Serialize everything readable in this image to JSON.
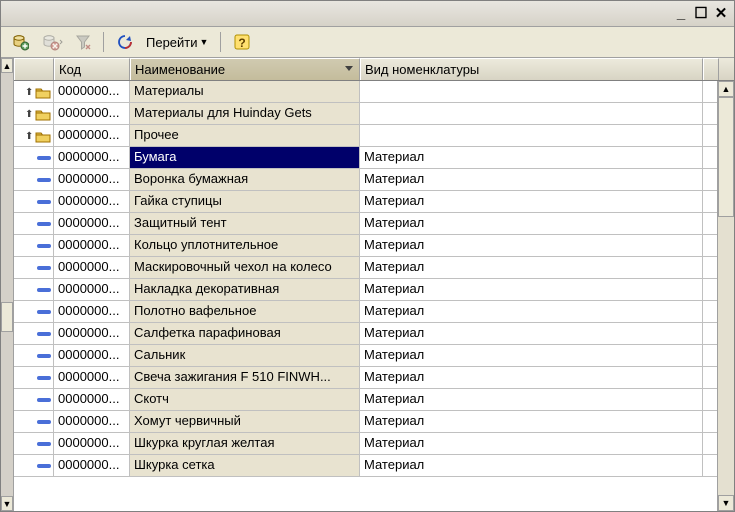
{
  "titlebar": {
    "minimize": "_",
    "maximize": "☐",
    "close": "✕"
  },
  "toolbar": {
    "goto_label": "Перейти",
    "goto_icon": "chevron-down"
  },
  "grid": {
    "headers": {
      "icon": "",
      "code": "Код",
      "name": "Наименование",
      "type": "Вид номенклатуры"
    },
    "rows": [
      {
        "kind": "folder",
        "code": "0000000...",
        "name": "Материалы",
        "type": ""
      },
      {
        "kind": "folder",
        "code": "0000000...",
        "name": "Материалы для Huinday Gets",
        "type": ""
      },
      {
        "kind": "folder",
        "code": "0000000...",
        "name": "Прочее",
        "type": ""
      },
      {
        "kind": "item",
        "code": "0000000...",
        "name": "Бумага",
        "type": "Материал",
        "selected": true
      },
      {
        "kind": "item",
        "code": "0000000...",
        "name": "Воронка бумажная",
        "type": "Материал"
      },
      {
        "kind": "item",
        "code": "0000000...",
        "name": "Гайка ступицы",
        "type": "Материал"
      },
      {
        "kind": "item",
        "code": "0000000...",
        "name": "Защитный тент",
        "type": "Материал"
      },
      {
        "kind": "item",
        "code": "0000000...",
        "name": "Кольцо уплотнительное",
        "type": "Материал"
      },
      {
        "kind": "item",
        "code": "0000000...",
        "name": "Маскировочный чехол на колесо",
        "type": "Материал"
      },
      {
        "kind": "item",
        "code": "0000000...",
        "name": "Накладка декоративная",
        "type": "Материал"
      },
      {
        "kind": "item",
        "code": "0000000...",
        "name": "Полотно вафельное",
        "type": "Материал"
      },
      {
        "kind": "item",
        "code": "0000000...",
        "name": "Салфетка парафиновая",
        "type": "Материал"
      },
      {
        "kind": "item",
        "code": "0000000...",
        "name": "Сальник",
        "type": "Материал"
      },
      {
        "kind": "item",
        "code": "0000000...",
        "name": "Свеча зажигания F 510 FINWH...",
        "type": "Материал"
      },
      {
        "kind": "item",
        "code": "0000000...",
        "name": "Скотч",
        "type": "Материал"
      },
      {
        "kind": "item",
        "code": "0000000...",
        "name": "Хомут червичный",
        "type": "Материал"
      },
      {
        "kind": "item",
        "code": "0000000...",
        "name": "Шкурка круглая желтая",
        "type": "Материал"
      },
      {
        "kind": "item",
        "code": "0000000...",
        "name": "Шкурка сетка",
        "type": "Материал"
      }
    ]
  }
}
